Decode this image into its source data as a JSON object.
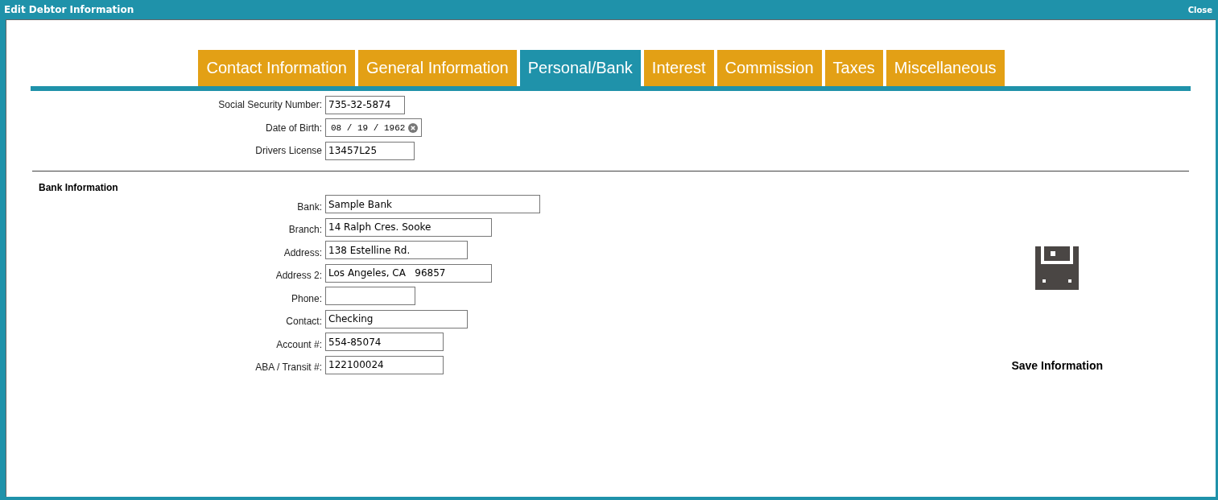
{
  "window": {
    "title": "Edit Debtor Information",
    "close": "Close"
  },
  "tabs": [
    {
      "label": "Contact Information",
      "selected": false
    },
    {
      "label": "General Information",
      "selected": false
    },
    {
      "label": "Personal/Bank",
      "selected": true
    },
    {
      "label": "Interest",
      "selected": false
    },
    {
      "label": "Commission",
      "selected": false
    },
    {
      "label": "Taxes",
      "selected": false
    },
    {
      "label": "Miscellaneous",
      "selected": false
    }
  ],
  "personal": {
    "fields": [
      {
        "kind": "text",
        "label": "Social Security Number:",
        "value": "735-32-5874"
      },
      {
        "kind": "date",
        "label": "Date of Birth:",
        "value": "08 / 19 / 1962"
      },
      {
        "kind": "text",
        "label": "Drivers License",
        "value": "13457L25"
      }
    ]
  },
  "bank": {
    "heading": "Bank Information",
    "fields": [
      {
        "kind": "text",
        "label": "Bank:",
        "value": "Sample Bank"
      },
      {
        "kind": "text",
        "label": "Branch:",
        "value": "14 Ralph Cres. Sooke"
      },
      {
        "kind": "text",
        "label": "Address:",
        "value": "138 Estelline Rd."
      },
      {
        "kind": "text",
        "label": "Address 2:",
        "value": "Los Angeles, CA   96857"
      },
      {
        "kind": "text",
        "label": "Phone:"
      },
      {
        "kind": "text",
        "label": "Contact:",
        "value": "Checking"
      },
      {
        "kind": "text",
        "label": "Account #:",
        "value": "554-85074"
      },
      {
        "kind": "text",
        "label": "ABA / Transit #:",
        "value": "122100024"
      }
    ]
  },
  "save": {
    "label": "Save Information"
  }
}
